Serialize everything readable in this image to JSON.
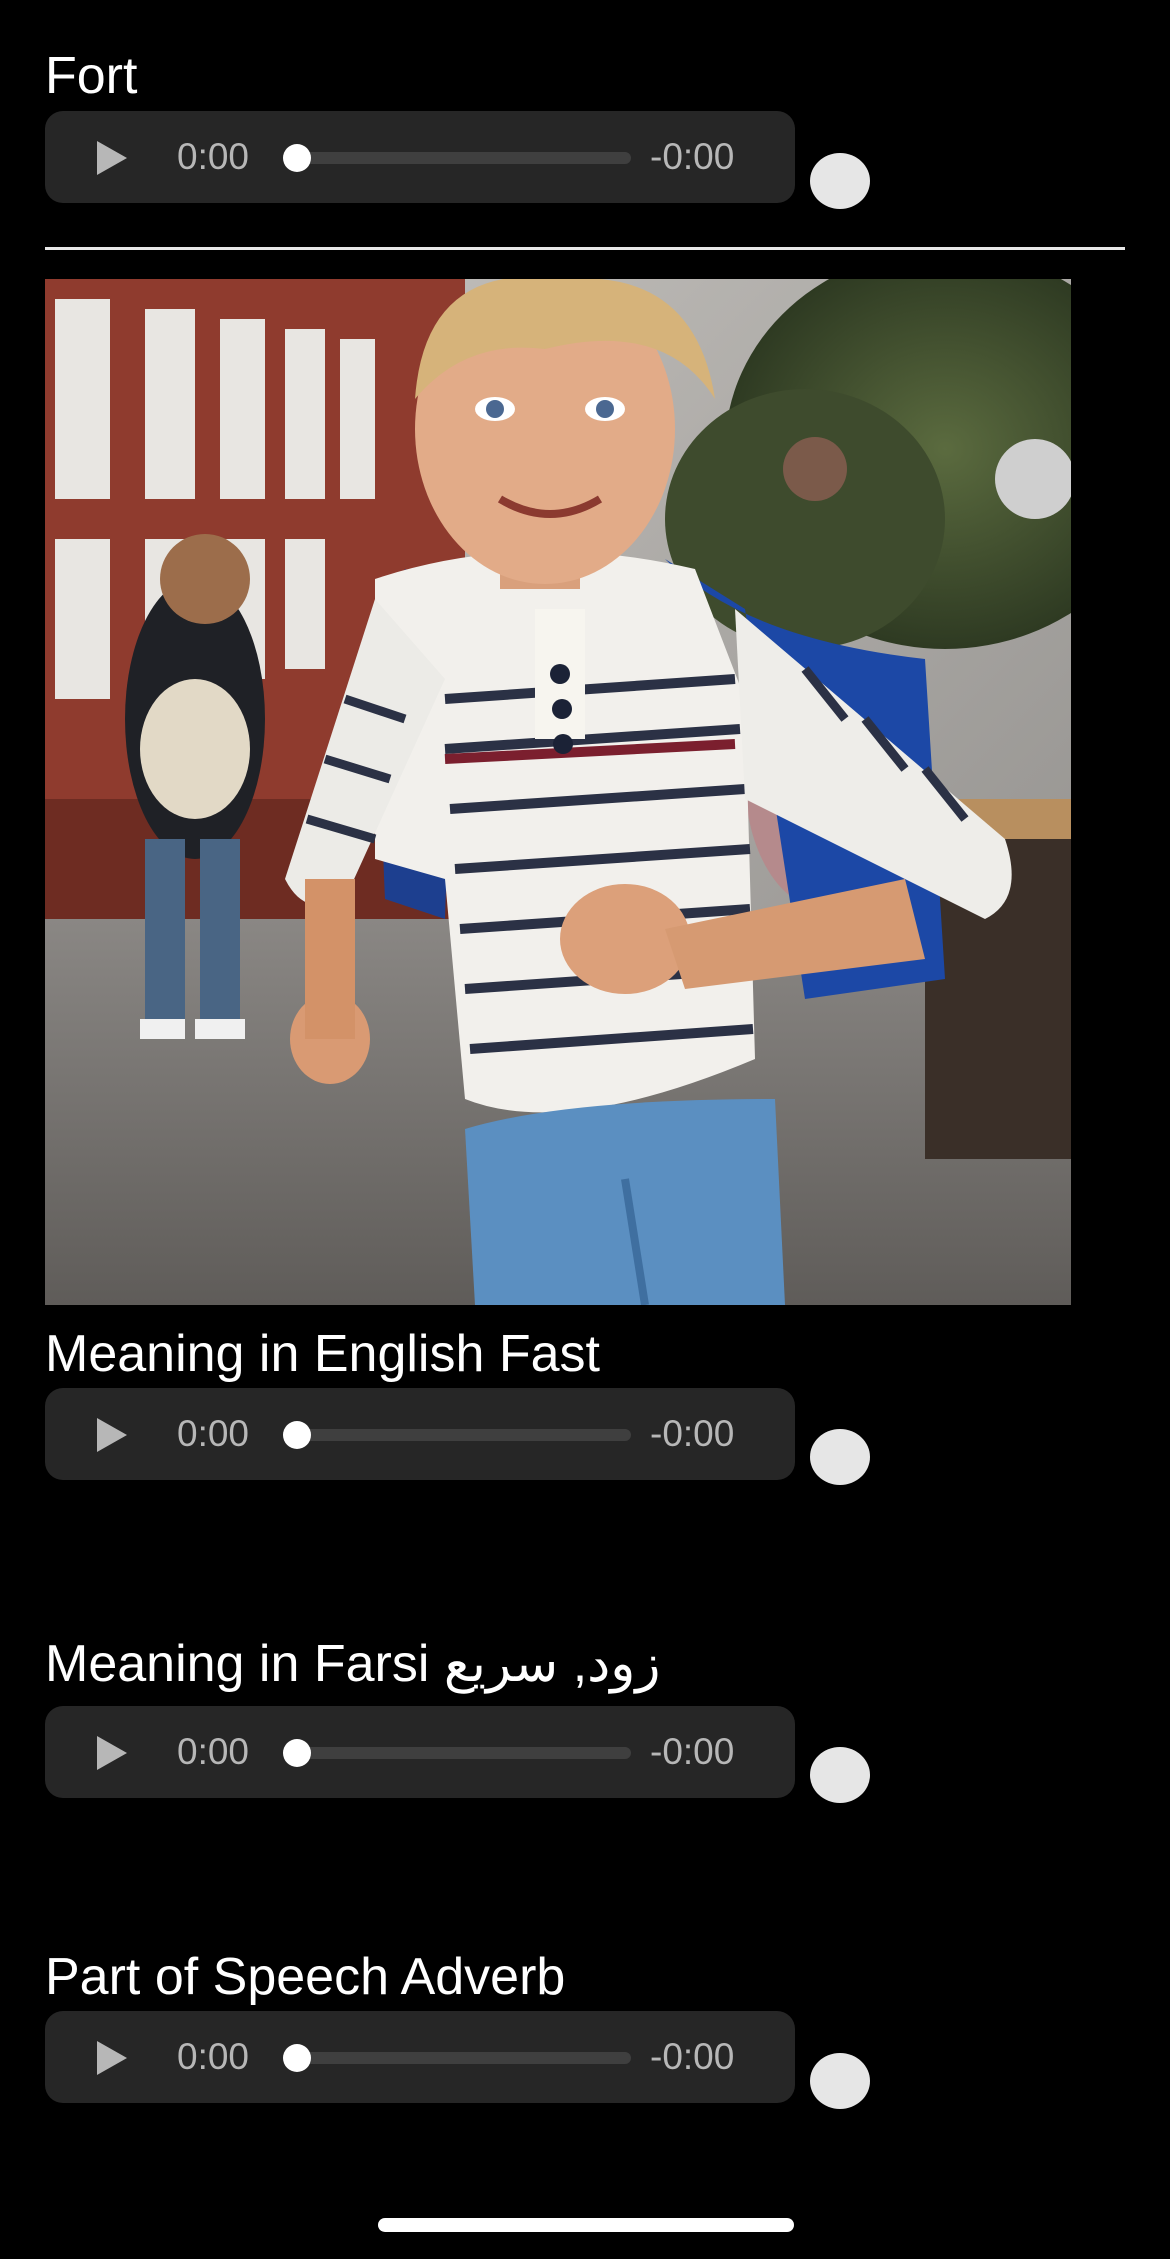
{
  "word": {
    "label": "Fort",
    "audio": {
      "current_time": "0:00",
      "remaining_time": "-0:00",
      "progress": 0
    }
  },
  "english": {
    "label": "Meaning in English Fast",
    "audio": {
      "current_time": "0:00",
      "remaining_time": "-0:00",
      "progress": 0
    }
  },
  "farsi": {
    "label": "Meaning in Farsi زود, سریع",
    "audio": {
      "current_time": "0:00",
      "remaining_time": "-0:00",
      "progress": 0
    }
  },
  "part_of_speech": {
    "label": "Part of Speech Adverb",
    "audio": {
      "current_time": "0:00",
      "remaining_time": "-0:00",
      "progress": 0
    }
  },
  "icons": {
    "play": "play-icon"
  },
  "colors": {
    "background": "#000000",
    "player_background": "#262626",
    "player_text": "#b7b7b7",
    "track": "#3f3f3f",
    "knob": "#ffffff",
    "toggle_dot": "#e6e6e6",
    "divider": "#e8e8e8"
  }
}
